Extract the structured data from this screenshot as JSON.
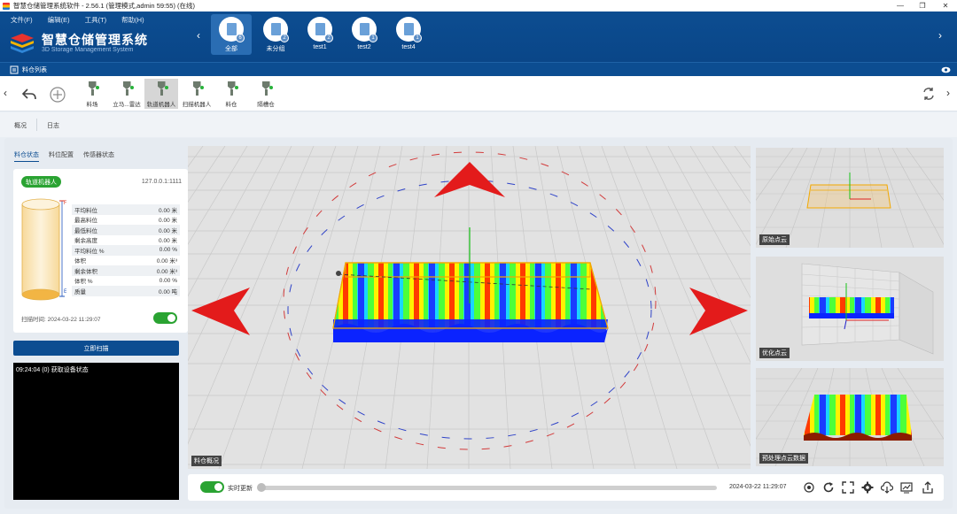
{
  "window": {
    "title": "智慧仓储管理系统软件 - 2.56.1 (管理模式,admin 59:55) (在线)",
    "controls": [
      "—",
      "❐",
      "✕"
    ]
  },
  "menu": [
    "文件(F)",
    "编辑(E)",
    "工具(T)",
    "帮助(H)"
  ],
  "brand": {
    "title": "智慧仓储管理系统",
    "subtitle": "3D Storage Management System"
  },
  "groups": [
    {
      "label": "全部",
      "count": "6",
      "active": true
    },
    {
      "label": "未分组",
      "count": "2",
      "active": false
    },
    {
      "label": "test1",
      "count": "2",
      "active": false
    },
    {
      "label": "test2",
      "count": "1",
      "active": false
    },
    {
      "label": "test4",
      "count": "1",
      "active": false
    }
  ],
  "subbar": {
    "title": "料仓列表"
  },
  "tools": [
    {
      "label": "料场",
      "active": false
    },
    {
      "label": "立马...雷达",
      "active": false
    },
    {
      "label": "轨道机器人",
      "active": true
    },
    {
      "label": "扫描机器人",
      "active": false
    },
    {
      "label": "料仓",
      "active": false
    },
    {
      "label": "隔槽仓",
      "active": false
    }
  ],
  "page_tabs": [
    "概况",
    "日志"
  ],
  "left_tabs": [
    "料仓状态",
    "料位配置",
    "传感器状态"
  ],
  "status": {
    "tag": "轨道机器人",
    "ip": "127.0.0.1:1111",
    "cyl_top_label": "F",
    "cyl_bottom_label": "E",
    "metrics": [
      {
        "name": "平均料位",
        "value": "0.00 米"
      },
      {
        "name": "最高料位",
        "value": "0.00 米"
      },
      {
        "name": "最低料位",
        "value": "0.00 米"
      },
      {
        "name": "剩余高度",
        "value": "0.00 米"
      },
      {
        "name": "平均料位 %",
        "value": "0.00 %"
      },
      {
        "name": "体积",
        "value": "0.00 米³"
      },
      {
        "name": "剩余体积",
        "value": "0.00 米³"
      },
      {
        "name": "体积 %",
        "value": "0.00 %"
      },
      {
        "name": "质量",
        "value": "0.00 吨"
      }
    ],
    "scan_time": "扫描时间: 2024-03-22 11:29:07"
  },
  "scan_button": "立即扫描",
  "console": [
    "09:24:04 (0) 获取设备状态"
  ],
  "views": {
    "main": "料仓概况",
    "raw": "原始点云",
    "optimized": "优化点云",
    "preprocessed": "预处理点云数据"
  },
  "bottom": {
    "realtime": "实时更新",
    "progress": 0,
    "timestamp": "2024-03-22 11:29:07"
  },
  "colors": {
    "primary": "#0c4d91",
    "accent_green": "#2aa332",
    "arrow_red": "#e31b1b"
  }
}
